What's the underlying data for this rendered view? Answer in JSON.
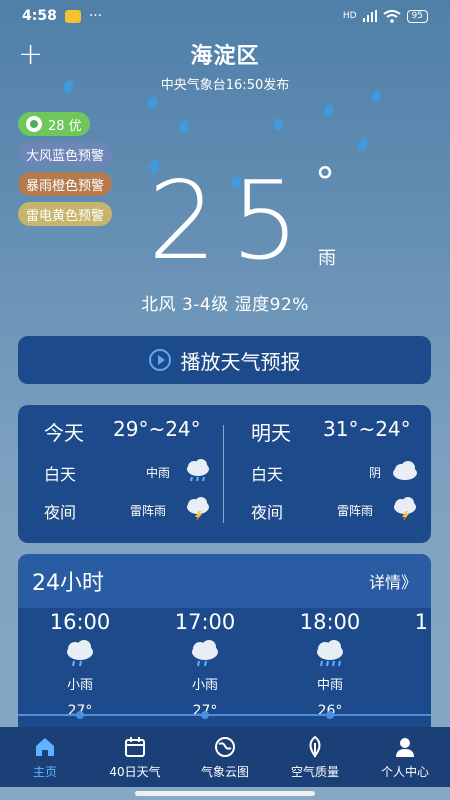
{
  "status": {
    "time": "4:58",
    "dots": "···",
    "signal": "HD",
    "battery": "95"
  },
  "header": {
    "location": "海淀区",
    "publish": "中央气象台16:50发布"
  },
  "badges": {
    "aqi": "28 优",
    "wind_warning": "大风蓝色预警",
    "rain_warning": "暴雨橙色预警",
    "thunder_warning": "雷电黄色预警"
  },
  "current": {
    "temp": "25",
    "deg": "°",
    "condition": "雨",
    "wind_humidity": "北风 3-4级  湿度92%"
  },
  "forecast_button": {
    "label": "播放天气预报"
  },
  "daily": {
    "today": {
      "title": "今天",
      "range": "29°~24°",
      "day_label": "白天",
      "day_cond": "中雨",
      "night_label": "夜间",
      "night_cond": "雷阵雨"
    },
    "tomorrow": {
      "title": "明天",
      "range": "31°~24°",
      "day_label": "白天",
      "day_cond": "阴",
      "night_label": "夜间",
      "night_cond": "雷阵雨"
    }
  },
  "hourly": {
    "title": "24小时",
    "detail": "详情》",
    "items": [
      {
        "time": "16:00",
        "cond": "小雨",
        "temp": "27°"
      },
      {
        "time": "17:00",
        "cond": "小雨",
        "temp": "27°"
      },
      {
        "time": "18:00",
        "cond": "中雨",
        "temp": "26°"
      },
      {
        "time": "1",
        "cond": "",
        "temp": ""
      }
    ]
  },
  "nav": [
    {
      "label": "主页",
      "icon": "home-icon"
    },
    {
      "label": "40日天气",
      "icon": "calendar-icon"
    },
    {
      "label": "气象云图",
      "icon": "globe-icon"
    },
    {
      "label": "空气质量",
      "icon": "leaf-icon"
    },
    {
      "label": "个人中心",
      "icon": "user-icon"
    }
  ],
  "colors": {
    "card": "#1d4a8a",
    "accent": "#5fb3ff",
    "aqi_green": "#6ec75a"
  }
}
